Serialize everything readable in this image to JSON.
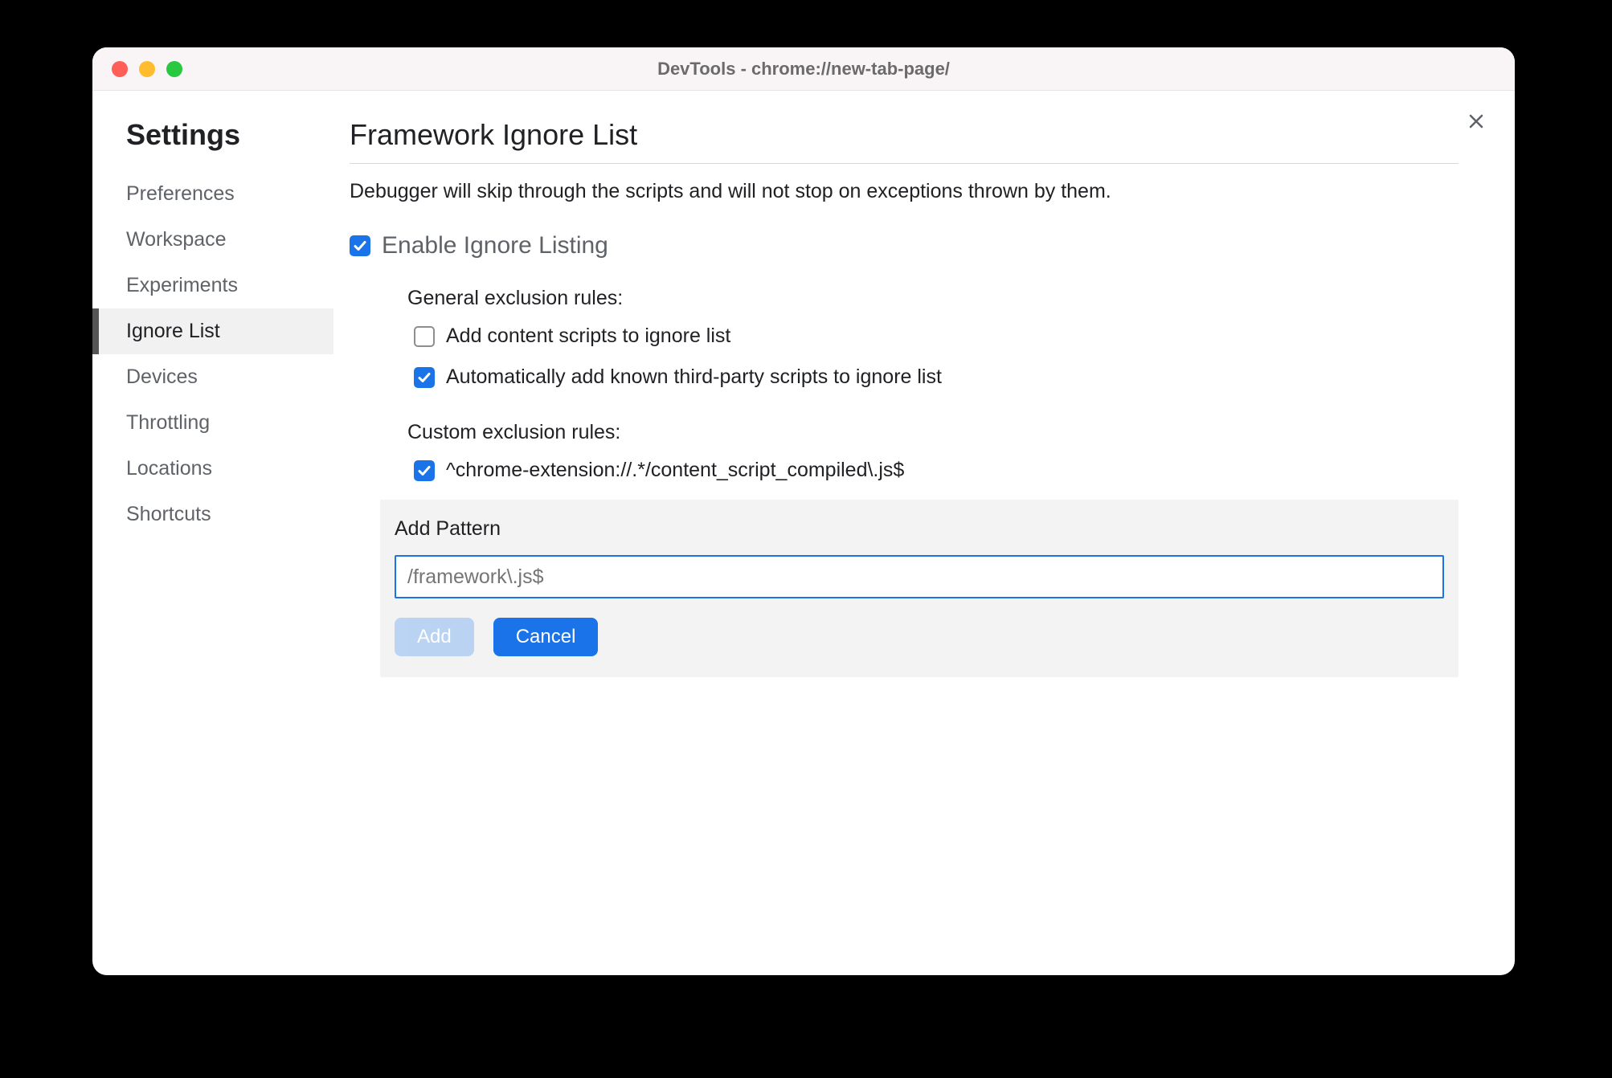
{
  "window": {
    "title": "DevTools - chrome://new-tab-page/"
  },
  "sidebar": {
    "title": "Settings",
    "items": [
      {
        "label": "Preferences",
        "active": false
      },
      {
        "label": "Workspace",
        "active": false
      },
      {
        "label": "Experiments",
        "active": false
      },
      {
        "label": "Ignore List",
        "active": true
      },
      {
        "label": "Devices",
        "active": false
      },
      {
        "label": "Throttling",
        "active": false
      },
      {
        "label": "Locations",
        "active": false
      },
      {
        "label": "Shortcuts",
        "active": false
      }
    ]
  },
  "main": {
    "title": "Framework Ignore List",
    "description": "Debugger will skip through the scripts and will not stop on exceptions thrown by them.",
    "enable": {
      "label": "Enable Ignore Listing",
      "checked": true
    },
    "general": {
      "title": "General exclusion rules:",
      "rules": [
        {
          "label": "Add content scripts to ignore list",
          "checked": false
        },
        {
          "label": "Automatically add known third-party scripts to ignore list",
          "checked": true
        }
      ]
    },
    "custom": {
      "title": "Custom exclusion rules:",
      "rules": [
        {
          "label": "^chrome-extension://.*/content_script_compiled\\.js$",
          "checked": true
        }
      ]
    },
    "add_panel": {
      "title": "Add Pattern",
      "placeholder": "/framework\\.js$",
      "add_label": "Add",
      "cancel_label": "Cancel"
    }
  }
}
